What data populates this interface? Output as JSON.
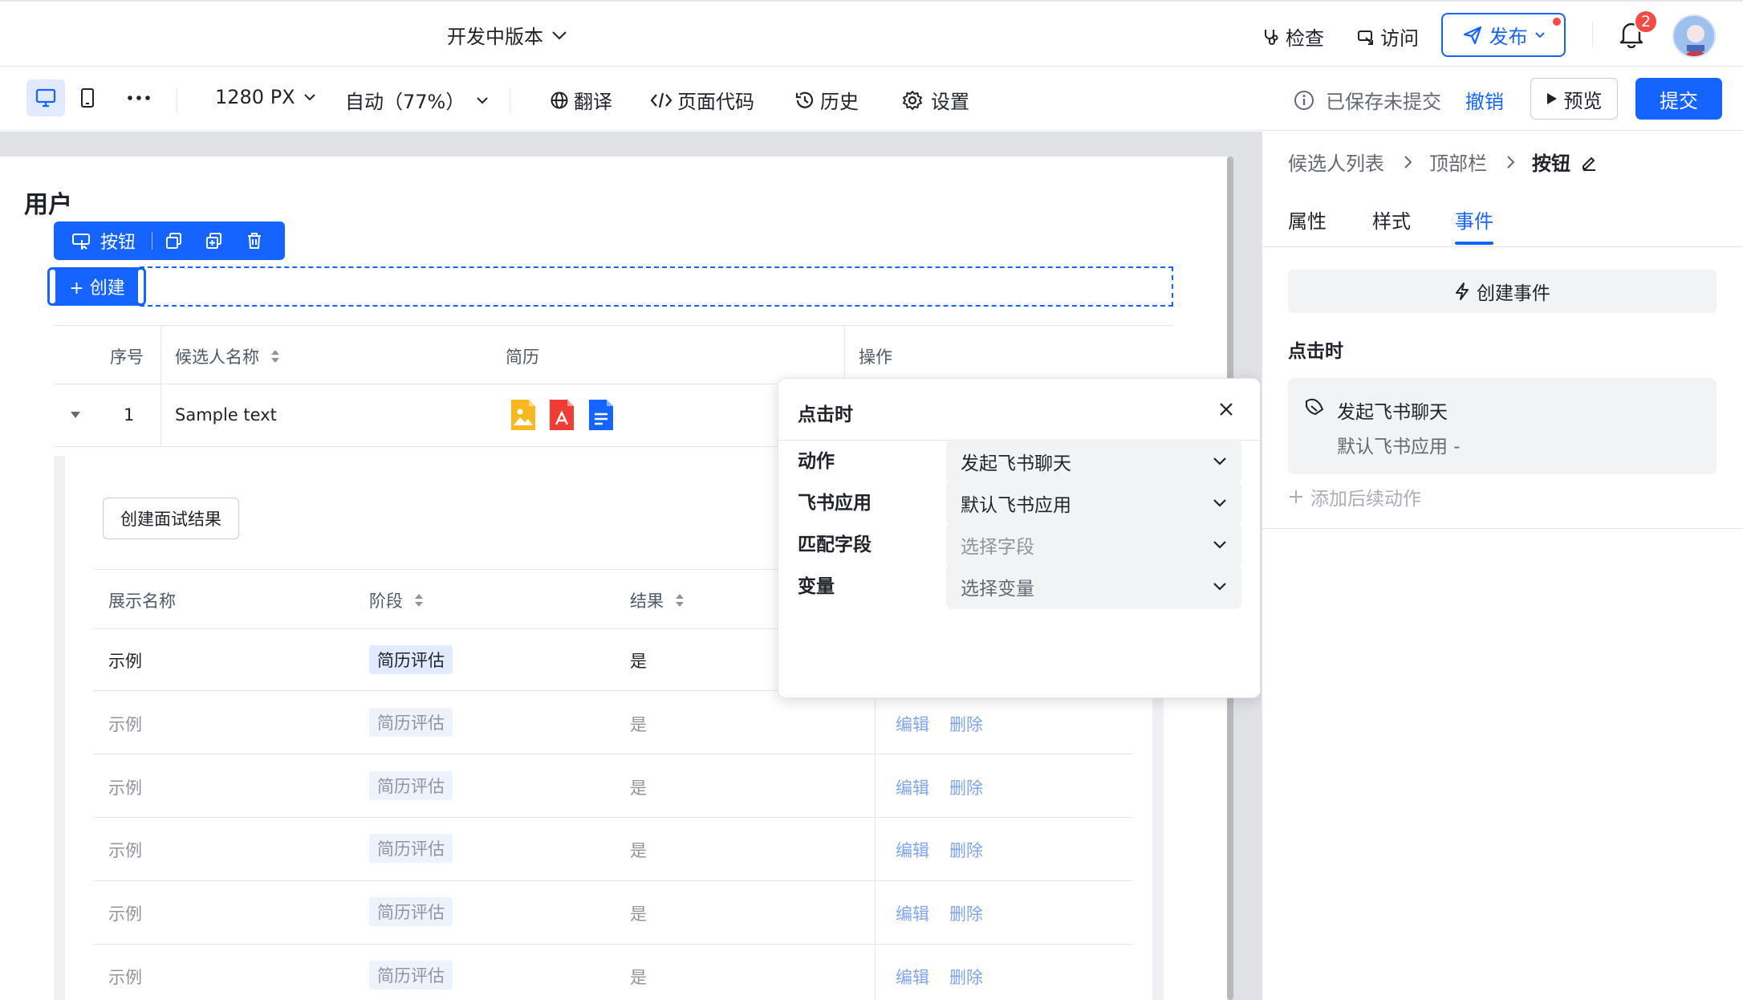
{
  "topbar": {
    "version_label": "开发中版本",
    "inspect_label": "检查",
    "visit_label": "访问",
    "publish_label": "发布",
    "notification_count": "2"
  },
  "toolbar": {
    "width_label": "1280 PX",
    "zoom_label": "自动（77%）",
    "translate_label": "翻译",
    "page_code_label": "页面代码",
    "history_label": "历史",
    "settings_label": "设置",
    "save_status": "已保存未提交",
    "undo_label": "撤销",
    "preview_label": "预览",
    "submit_label": "提交"
  },
  "canvas": {
    "page_title": "用户",
    "component_bar": {
      "label": "按钮"
    },
    "create_button_label": "+ 创建",
    "main_table": {
      "headers": [
        "序号",
        "候选人名称",
        "简历",
        "操作"
      ],
      "rows": [
        {
          "index": "1",
          "name": "Sample text"
        }
      ]
    },
    "create_result_button": "创建面试结果",
    "sub_table": {
      "headers": [
        "展示名称",
        "阶段",
        "结果"
      ],
      "rows": [
        {
          "name": "示例",
          "stage": "简历评估",
          "result": "是",
          "edit": "",
          "delete": ""
        },
        {
          "name": "示例",
          "stage": "简历评估",
          "result": "是",
          "edit": "编辑",
          "delete": "删除"
        },
        {
          "name": "示例",
          "stage": "简历评估",
          "result": "是",
          "edit": "编辑",
          "delete": "删除"
        },
        {
          "name": "示例",
          "stage": "简历评估",
          "result": "是",
          "edit": "编辑",
          "delete": "删除"
        },
        {
          "name": "示例",
          "stage": "简历评估",
          "result": "是",
          "edit": "编辑",
          "delete": "删除"
        },
        {
          "name": "示例",
          "stage": "简历评估",
          "result": "是",
          "edit": "编辑",
          "delete": "删除"
        }
      ]
    }
  },
  "popover": {
    "title": "点击时",
    "fields": [
      {
        "label": "动作",
        "value": "发起飞书聊天",
        "placeholder": false
      },
      {
        "label": "飞书应用",
        "value": "默认飞书应用",
        "placeholder": false
      },
      {
        "label": "匹配字段",
        "value": "选择字段",
        "placeholder": true
      },
      {
        "label": "变量",
        "value": "选择变量",
        "placeholder": true
      }
    ]
  },
  "panel": {
    "breadcrumb": [
      "候选人列表",
      "顶部栏",
      "按钮"
    ],
    "tabs": [
      "属性",
      "样式",
      "事件"
    ],
    "active_tab": "事件",
    "create_event_label": "创建事件",
    "on_click_label": "点击时",
    "action_title": "发起飞书聊天",
    "action_sub": "默认飞书应用 -",
    "add_followup_label": "添加后续动作"
  },
  "colors": {
    "accent": "#1664ff",
    "badge": "#f54a45"
  }
}
